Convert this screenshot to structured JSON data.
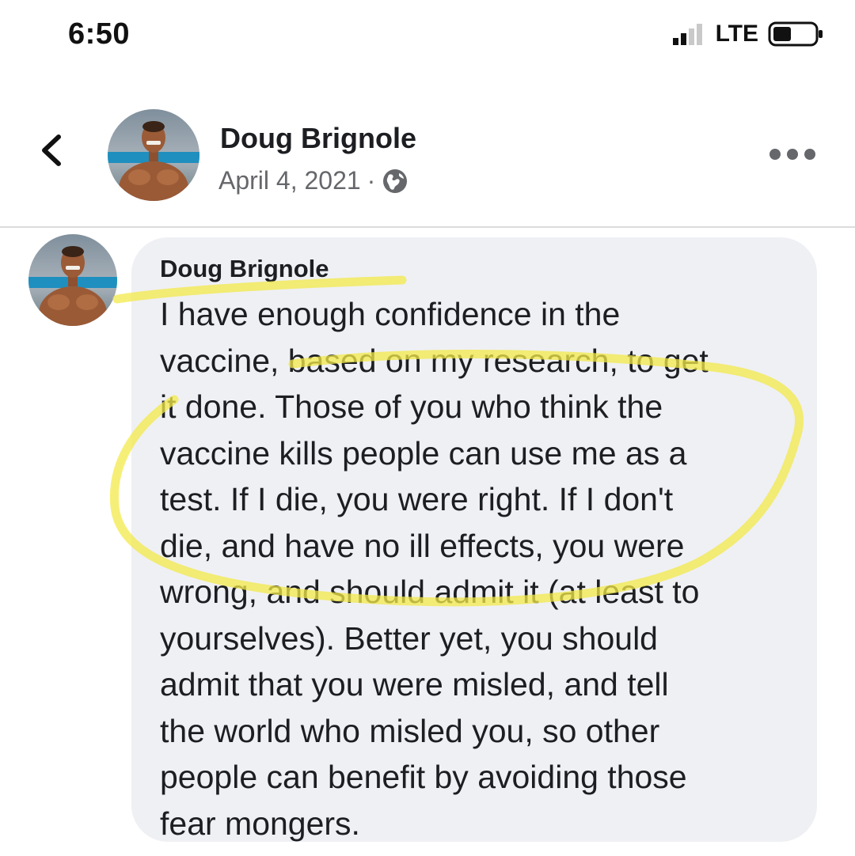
{
  "status_bar": {
    "time": "6:50",
    "network": "LTE",
    "icons": [
      "signal-icon",
      "battery-icon"
    ]
  },
  "post_header": {
    "back_icon": "chevron-left-icon",
    "author": "Doug Brignole",
    "date": "April 4, 2021",
    "separator": "·",
    "audience_icon": "globe-icon",
    "more_icon": "more-options-icon"
  },
  "comment": {
    "author": "Doug Brignole",
    "lines": [
      "I have enough confidence in the",
      "vaccine, based on my research, to get",
      "it done. Those of you who think the",
      "vaccine kills people can use me as a",
      "test. If I die, you were right. If I don't",
      "die, and have no ill effects, you were",
      "wrong, and should admit it (at least to",
      "yourselves). Better yet, you should",
      "admit that you were misled, and tell",
      "the world who misled you, so other",
      "people can benefit by avoiding those",
      "fear mongers."
    ]
  },
  "colors": {
    "bubble": "#eff0f4",
    "highlight": "#f3e94a",
    "secondary_text": "#65676b"
  }
}
